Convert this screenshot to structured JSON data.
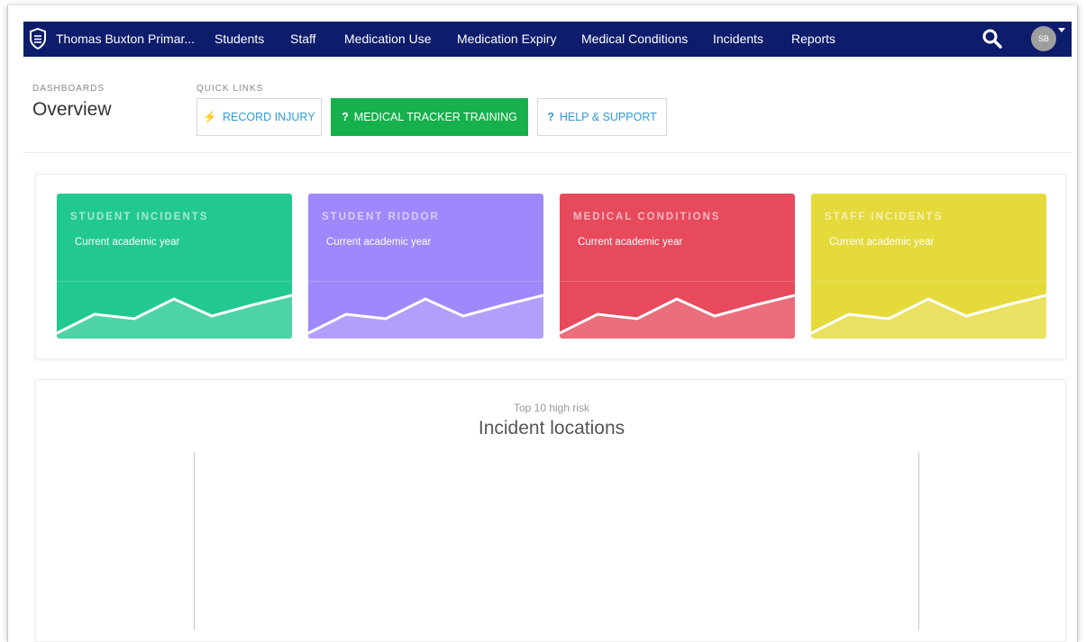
{
  "nav": {
    "school": "Thomas Buxton Primar...",
    "items": [
      "Students",
      "Staff",
      "Medication Use",
      "Medication Expiry",
      "Medical Conditions",
      "Incidents",
      "Reports"
    ],
    "avatar": "SB"
  },
  "header": {
    "section": "DASHBOARDS",
    "title": "Overview",
    "quick_links_label": "QUICK LINKS"
  },
  "quick_links": [
    {
      "icon": "⚡",
      "label": "RECORD INJURY"
    },
    {
      "icon": "?",
      "label": "MEDICAL TRACKER TRAINING"
    },
    {
      "icon": "?",
      "label": "HELP & SUPPORT"
    }
  ],
  "cards": [
    {
      "title": "STUDENT INCIDENTS",
      "subtitle": "Current academic year",
      "color": "#22c98f"
    },
    {
      "title": "STUDENT RIDDOR",
      "subtitle": "Current academic year",
      "color": "#a087fb"
    },
    {
      "title": "MEDICAL CONDITIONS",
      "subtitle": "Current academic year",
      "color": "#e64a5c"
    },
    {
      "title": "STAFF INCIDENTS",
      "subtitle": "Current academic year",
      "color": "#e5da3c"
    }
  ],
  "chart": {
    "subtitle": "Top 10 high risk",
    "title": "Incident locations"
  }
}
